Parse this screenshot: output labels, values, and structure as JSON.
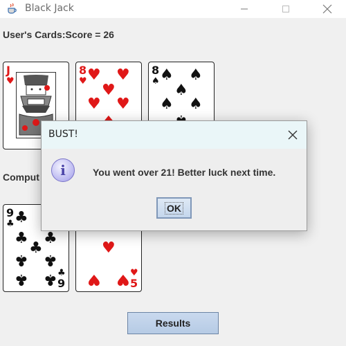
{
  "window": {
    "title": "Black Jack",
    "icon": "java-coffee-icon"
  },
  "user": {
    "label": "User's Cards:Score = 26",
    "cards": [
      {
        "rank": "J",
        "suit": "♥",
        "color": "red"
      },
      {
        "rank": "8",
        "suit": "♥",
        "color": "red"
      },
      {
        "rank": "8",
        "suit": "♠",
        "color": "black"
      }
    ]
  },
  "computer": {
    "label": "Comput",
    "cards": [
      {
        "rank": "9",
        "suit": "♣",
        "color": "black"
      },
      {
        "rank": "5",
        "suit": "♥",
        "color": "red"
      }
    ]
  },
  "results_button": "Results",
  "dialog": {
    "title": "BUST!",
    "message": "You went over 21! Better luck next time.",
    "ok_label": "OK",
    "icon": "info-icon"
  },
  "colors": {
    "red_suit": "#e01818",
    "black_suit": "#111111",
    "button_blue": "#b6cbe5",
    "dialog_titlebar": "#eaf6f8"
  }
}
